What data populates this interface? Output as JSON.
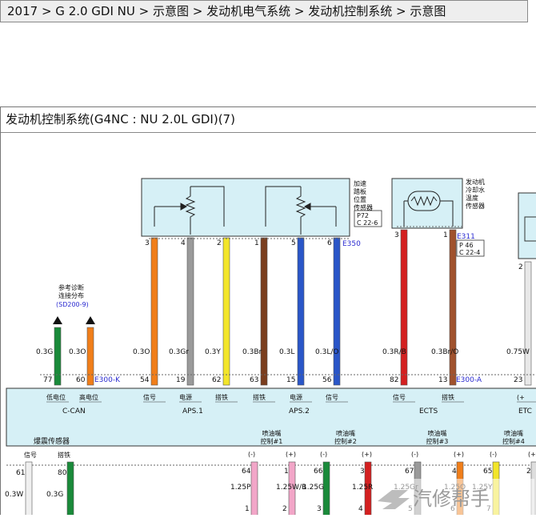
{
  "breadcrumb": {
    "items": [
      "2017",
      "G 2.0 GDI NU",
      "示意图",
      "发动机电气系统",
      "发动机控制系统",
      "示意图"
    ],
    "separator": " > "
  },
  "panel": {
    "title": "发动机控制系统(G4NC : NU 2.0L GDI)(7)"
  },
  "components": {
    "aps": {
      "label_lines": [
        "加速",
        "踏板",
        "位置",
        "传感器"
      ],
      "ref_p": "P72",
      "ref_c": "C 22-6",
      "connector": "E350"
    },
    "ects": {
      "label_lines": [
        "发动机",
        "冷却水",
        "温度",
        "传感器"
      ],
      "ref_p": "P 46",
      "ref_c": "C 22-4",
      "connector": "E311"
    },
    "ref_note": {
      "lines": [
        "参考诊断",
        "连接分布",
        "(SD200-9)"
      ]
    },
    "knock": {
      "label": "爆震传感器",
      "sig": "信号",
      "gnd": "搭铁"
    }
  },
  "wires": [
    {
      "pin_top": "",
      "pin_bottom": "77",
      "size": "0.3G",
      "color": "#1a8a3a"
    },
    {
      "pin_top": "",
      "pin_bottom": "60",
      "size": "0.3O",
      "color": "#f07e1a"
    },
    {
      "pin_top": "3",
      "pin_bottom": "54",
      "size": "0.3O",
      "color": "#f07e1a"
    },
    {
      "pin_top": "4",
      "pin_bottom": "19",
      "size": "0.3Gr",
      "color": "#9a9a9a"
    },
    {
      "pin_top": "2",
      "pin_bottom": "62",
      "size": "0.3Y",
      "color": "#f2e52a"
    },
    {
      "pin_top": "1",
      "pin_bottom": "63",
      "size": "0.3Br",
      "color": "#7a3e1e"
    },
    {
      "pin_top": "5",
      "pin_bottom": "15",
      "size": "0.3L",
      "color": "#2a56c8"
    },
    {
      "pin_top": "6",
      "pin_bottom": "56",
      "size": "0.3L/O",
      "color": "#2a56c8"
    },
    {
      "pin_top": "3",
      "pin_bottom": "82",
      "size": "0.3R/B",
      "color": "#d42020"
    },
    {
      "pin_top": "1",
      "pin_bottom": "13",
      "size": "0.3Br/O",
      "color": "#a0522d"
    },
    {
      "pin_top": "2",
      "pin_bottom": "23",
      "size": "0.75W",
      "color": "#e8e8e8"
    }
  ],
  "ecm": {
    "connector_k": "E300-K",
    "connector_a": "E300-A",
    "labels": [
      "低电位",
      "高电位",
      "信号",
      "电源",
      "搭铁",
      "搭铁",
      "电源",
      "信号",
      "信号",
      "搭铁",
      "(+"
    ],
    "groups": [
      "C-CAN",
      "APS.1",
      "APS.2",
      "ECTS",
      "ETC"
    ]
  },
  "injectors": [
    {
      "title_lines": [
        "喷油嘴",
        "控制#1"
      ],
      "neg": "(-)",
      "pos": "(+)",
      "pin_l": "64",
      "pin_r": "1",
      "size_l": "1.25P",
      "size_r": "1.25W/B",
      "low_l": "1",
      "low_r": "2"
    },
    {
      "title_lines": [
        "喷油嘴",
        "控制#2"
      ],
      "neg": "(-)",
      "pos": "(+)",
      "pin_l": "66",
      "pin_r": "3",
      "size_l": "1.25G",
      "size_r": "1.25R",
      "low_l": "3",
      "low_r": "4"
    },
    {
      "title_lines": [
        "喷油嘴",
        "控制#3"
      ],
      "neg": "(-)",
      "pos": "(+)",
      "pin_l": "67",
      "pin_r": "4",
      "size_l": "1.25Gr",
      "size_r": "1.25O",
      "low_l": "5",
      "low_r": "6"
    },
    {
      "title_lines": [
        "喷油嘴",
        "控制#4"
      ],
      "neg": "(-)",
      "pos": "(+)",
      "pin_l": "65",
      "pin_r": "2",
      "size_l": "1.25Y",
      "size_r": "",
      "low_l": "7",
      "low_r": ""
    }
  ],
  "knock_wires": {
    "pin_l": "61",
    "pin_r": "80",
    "size_l": "0.3W",
    "size_r": "0.3G"
  },
  "watermark": {
    "text": "汽修帮手"
  },
  "colors": {
    "ecm_fill": "#d6f0f6",
    "box_fill": "#d6f0f6",
    "link_blue": "#2a2ad0"
  }
}
